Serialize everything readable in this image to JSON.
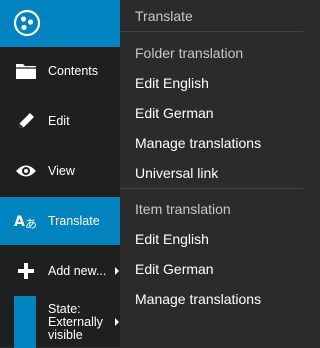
{
  "toolbar": {
    "items": [
      {
        "label": "Contents",
        "icon": "folder-icon"
      },
      {
        "label": "Edit",
        "icon": "pencil-icon"
      },
      {
        "label": "View",
        "icon": "eye-icon"
      },
      {
        "label": "Translate",
        "icon": "translate-icon"
      },
      {
        "label": "Add new...",
        "icon": "plus-icon"
      }
    ],
    "state_label": "State: Externally visible"
  },
  "menu": {
    "title": "Translate",
    "folder_section": {
      "header": "Folder translation",
      "items": [
        "Edit English",
        "Edit German",
        "Manage translations",
        "Universal link"
      ]
    },
    "item_section": {
      "header": "Item translation",
      "items": [
        "Edit English",
        "Edit German",
        "Manage translations"
      ]
    }
  },
  "colors": {
    "accent": "#0083be",
    "toolbar_bg": "#1f1f1f",
    "menu_bg": "#2b2b2b"
  }
}
